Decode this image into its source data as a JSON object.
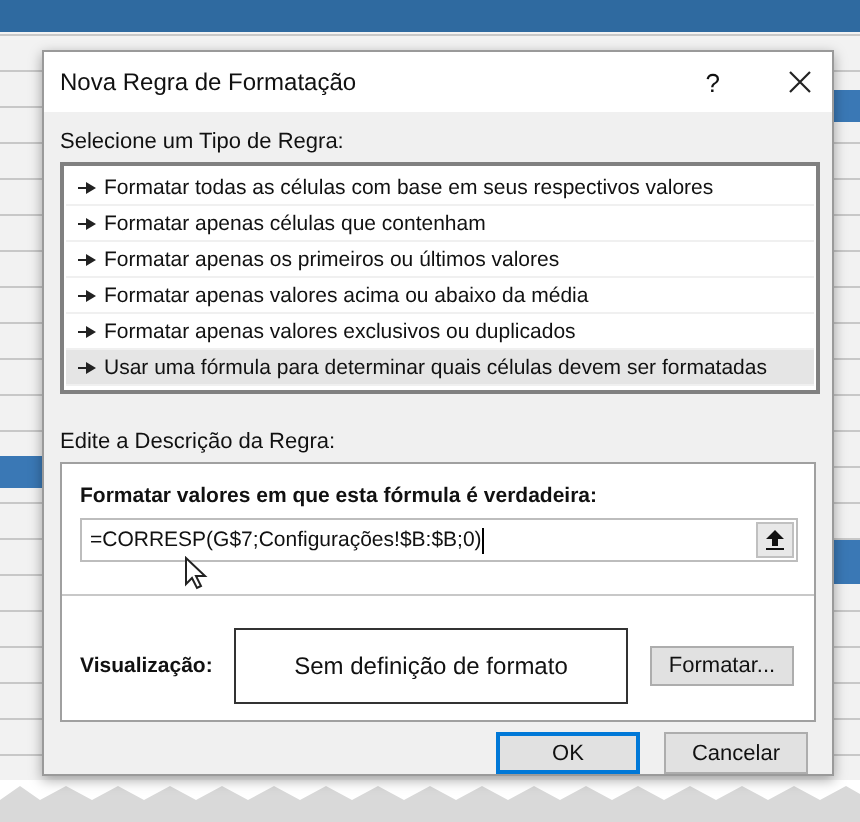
{
  "dialog": {
    "title": "Nova Regra de Formatação",
    "help": "?"
  },
  "rule_type": {
    "label": "Selecione um Tipo de Regra:",
    "items": [
      {
        "label": "Formatar todas as células com base em seus respectivos valores",
        "selected": false
      },
      {
        "label": "Formatar apenas células que contenham",
        "selected": false
      },
      {
        "label": "Formatar apenas os primeiros ou últimos valores",
        "selected": false
      },
      {
        "label": "Formatar apenas valores acima ou abaixo da média",
        "selected": false
      },
      {
        "label": "Formatar apenas valores exclusivos ou duplicados",
        "selected": false
      },
      {
        "label": "Usar uma fórmula para determinar quais células devem ser formatadas",
        "selected": true
      }
    ]
  },
  "description": {
    "label": "Edite a Descrição da Regra:",
    "formula_label": "Formatar valores em que esta fórmula é verdadeira:",
    "formula": "=CORRESP(G$7;Configurações!$B:$B;0)",
    "preview_label": "Visualização:",
    "preview_text": "Sem definição de formato",
    "format_button": "Formatar..."
  },
  "buttons": [
    "OK",
    "Cancelar"
  ]
}
